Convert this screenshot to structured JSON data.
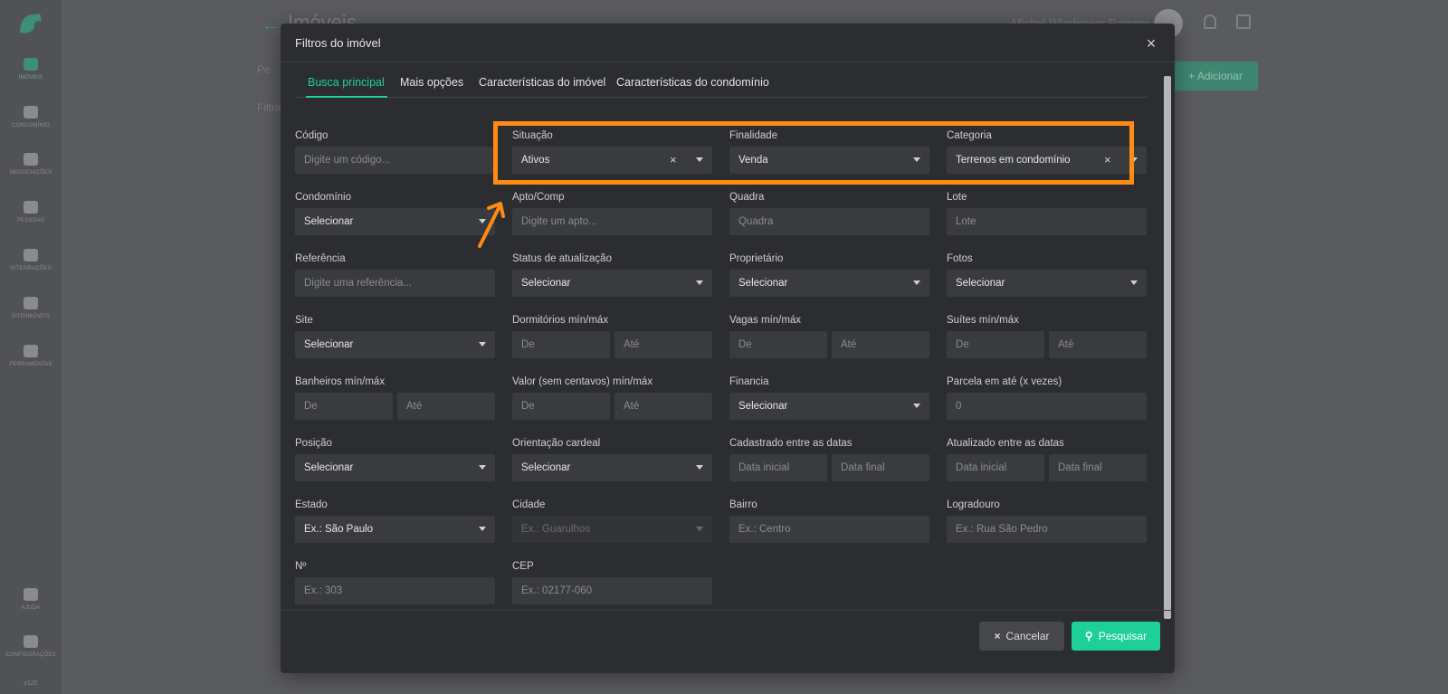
{
  "app": {
    "version": "v120",
    "page_title": "Imóveis",
    "user_name": "Michel Wladimeor Romero",
    "add_label": "+ Adicionar",
    "search_placeholder": "Pe",
    "filter_label": "Filtra",
    "nav": [
      {
        "label": "Imóveis",
        "icon": "home-icon",
        "active": true
      },
      {
        "label": "Condomínio",
        "icon": "building-icon"
      },
      {
        "label": "Negociações",
        "icon": "handshake-icon"
      },
      {
        "label": "Pessoas",
        "icon": "people-icon"
      },
      {
        "label": "Integrações",
        "icon": "plug-icon"
      },
      {
        "label": "Site/Imóveis",
        "icon": "monitor-icon"
      },
      {
        "label": "Ferramentas",
        "icon": "tools-icon"
      },
      {
        "label": "Ajuda",
        "icon": "help-icon"
      },
      {
        "label": "Configurações",
        "icon": "gear-icon"
      }
    ]
  },
  "modal": {
    "title": "Filtros do imóvel",
    "tabs": [
      "Busca principal",
      "Mais opções",
      "Características do imóvel",
      "Características do condomínio"
    ],
    "fields": {
      "codigo": {
        "label": "Código",
        "placeholder": "Digite um código..."
      },
      "situacao": {
        "label": "Situação",
        "value": "Ativos"
      },
      "finalidade": {
        "label": "Finalidade",
        "value": "Venda"
      },
      "categoria": {
        "label": "Categoria",
        "value": "Terrenos em condomínio"
      },
      "condominio": {
        "label": "Condomínio",
        "value": "Selecionar"
      },
      "apto": {
        "label": "Apto/Comp",
        "placeholder": "Digite um apto..."
      },
      "quadra": {
        "label": "Quadra",
        "placeholder": "Quadra"
      },
      "lote": {
        "label": "Lote",
        "placeholder": "Lote"
      },
      "referencia": {
        "label": "Referência",
        "placeholder": "Digite uma referência..."
      },
      "status": {
        "label": "Status de atualização",
        "value": "Selecionar"
      },
      "proprietario": {
        "label": "Proprietário",
        "value": "Selecionar"
      },
      "fotos": {
        "label": "Fotos",
        "value": "Selecionar"
      },
      "site": {
        "label": "Site",
        "value": "Selecionar"
      },
      "dormitorios": {
        "label": "Dormitórios mín/máx",
        "min_placeholder": "De",
        "max_placeholder": "Até"
      },
      "vagas": {
        "label": "Vagas mín/máx",
        "min_placeholder": "De",
        "max_placeholder": "Até"
      },
      "suites": {
        "label": "Suítes mín/máx",
        "min_placeholder": "De",
        "max_placeholder": "Até"
      },
      "banheiros": {
        "label": "Banheiros mín/máx",
        "min_placeholder": "De",
        "max_placeholder": "Até"
      },
      "valor": {
        "label": "Valor (sem centavos) mín/máx",
        "min_placeholder": "De",
        "max_placeholder": "Até"
      },
      "financia": {
        "label": "Financia",
        "value": "Selecionar"
      },
      "parcela": {
        "label": "Parcela em até (x vezes)",
        "placeholder": "0"
      },
      "posicao": {
        "label": "Posição",
        "value": "Selecionar"
      },
      "orientacao": {
        "label": "Orientação cardeal",
        "value": "Selecionar"
      },
      "cadastrado": {
        "label": "Cadastrado entre as datas",
        "min_placeholder": "Data inicial",
        "max_placeholder": "Data final"
      },
      "atualizado": {
        "label": "Atualizado entre as datas",
        "min_placeholder": "Data inicial",
        "max_placeholder": "Data final"
      },
      "estado": {
        "label": "Estado",
        "value": "Ex.: São Paulo"
      },
      "cidade": {
        "label": "Cidade",
        "value": "Ex.: Guarulhos"
      },
      "bairro": {
        "label": "Bairro",
        "placeholder": "Ex.: Centro"
      },
      "logradouro": {
        "label": "Logradouro",
        "placeholder": "Ex.: Rua São Pedro"
      },
      "numero": {
        "label": "Nº",
        "placeholder": "Ex.: 303"
      },
      "cep": {
        "label": "CEP",
        "placeholder": "Ex.: 02177-060"
      }
    },
    "footer": {
      "cancel_label": "Cancelar",
      "search_label": "Pesquisar"
    }
  },
  "annotation": {
    "highlight_color": "#ff8a14"
  },
  "colors": {
    "accent": "#1fcf98",
    "modal_bg": "#2c2d30",
    "input_bg": "#3a3b3e"
  }
}
